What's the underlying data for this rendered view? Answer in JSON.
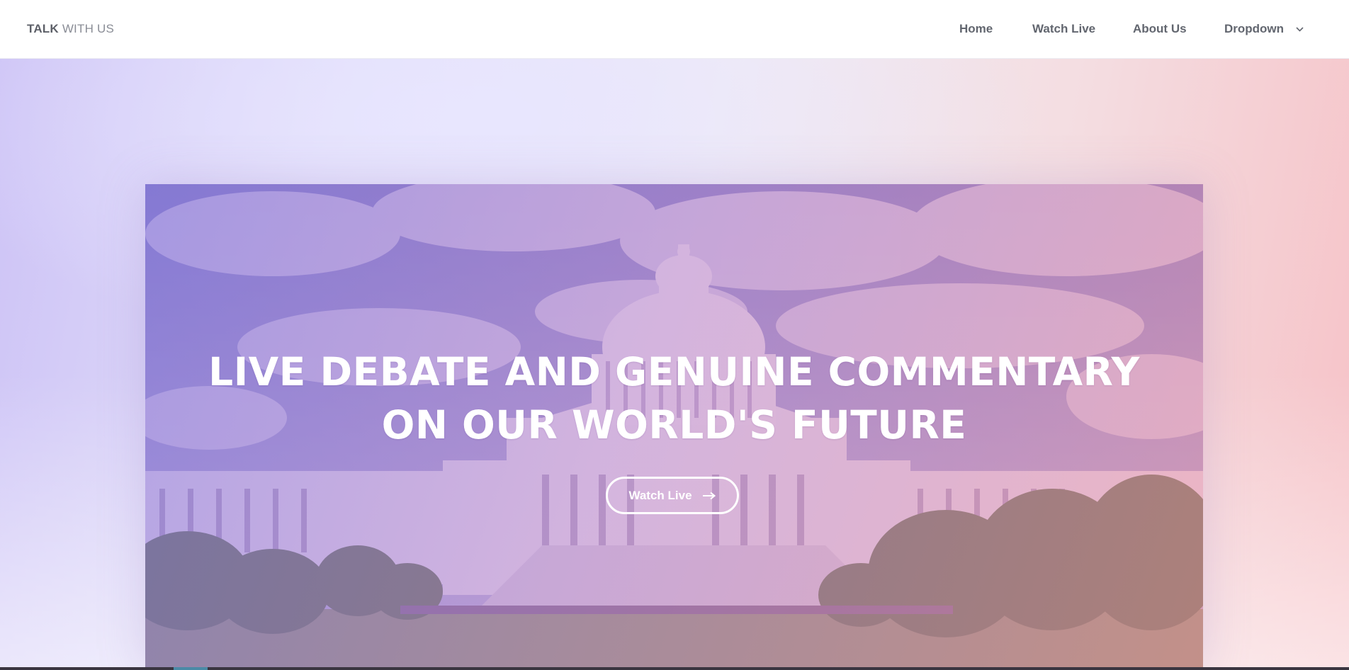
{
  "brand": {
    "bold": "TALK",
    "light": "WITH US"
  },
  "nav": {
    "home": "Home",
    "watch_live": "Watch Live",
    "about": "About Us",
    "dropdown": "Dropdown"
  },
  "hero": {
    "headline_line1": "LIVE DEBATE AND GENUINE COMMENTARY",
    "headline_line2": "ON OUR WORLD'S FUTURE",
    "button_label": "Watch Live",
    "button_icon": "arrow-right-icon",
    "image": "capitol-building-photo"
  },
  "colors": {
    "nav_text": "#62666f",
    "overlay_left": "#7d6edc",
    "overlay_right": "#eb8796",
    "hero_text": "#ffffff"
  }
}
